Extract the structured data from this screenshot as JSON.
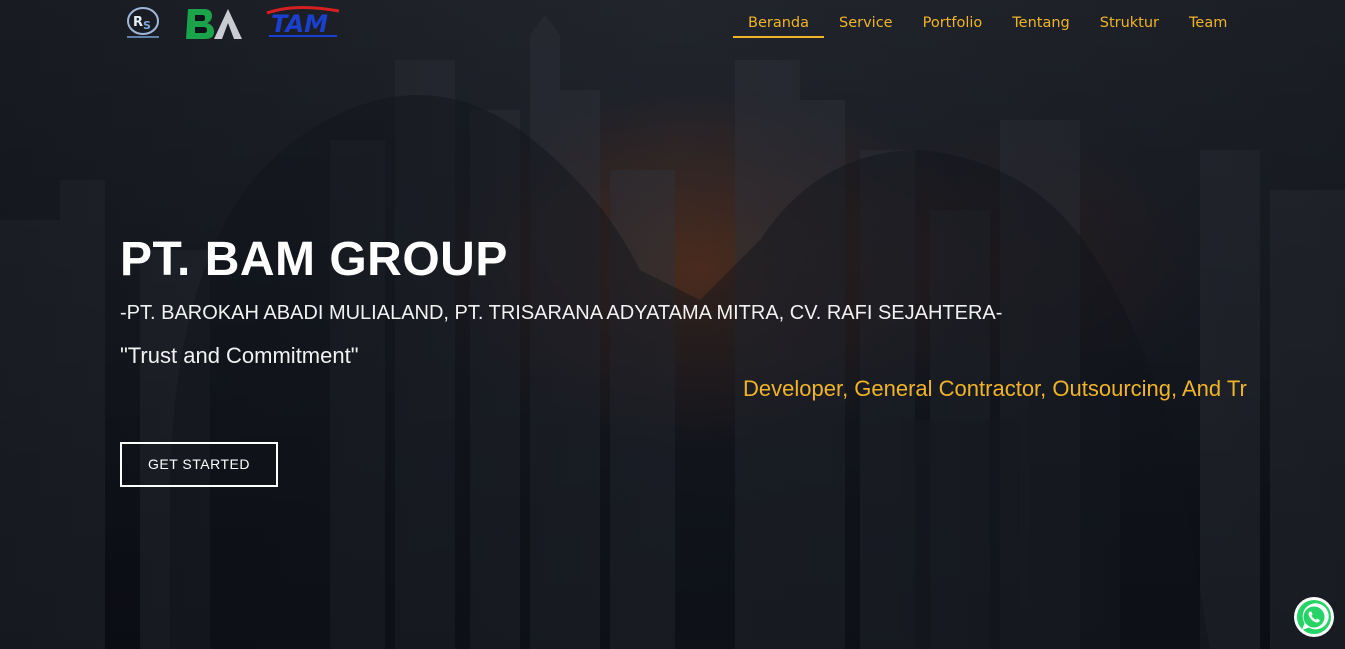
{
  "header": {
    "logos": [
      {
        "name": "rs-logo",
        "text": "RS"
      },
      {
        "name": "ba-logo",
        "text": "BA"
      },
      {
        "name": "tam-logo",
        "text": "TAM"
      }
    ],
    "nav": [
      {
        "label": "Beranda",
        "active": true
      },
      {
        "label": "Service",
        "active": false
      },
      {
        "label": "Portfolio",
        "active": false
      },
      {
        "label": "Tentang",
        "active": false
      },
      {
        "label": "Struktur",
        "active": false
      },
      {
        "label": "Team",
        "active": false
      }
    ]
  },
  "hero": {
    "title": "PT. BAM GROUP",
    "subtitle": "-PT. BAROKAH ABADI MULIALAND, PT. TRISARANA ADYATAMA MITRA, CV. RAFI SEJAHTERA-",
    "tagline": "\"Trust and Commitment\"",
    "marquee": "Developer, General Contractor, Outsourcing, And Tr",
    "cta_label": "GET STARTED"
  },
  "floating": {
    "icon": "whatsapp-icon"
  },
  "colors": {
    "accent": "#f0b428",
    "text": "#ffffff",
    "background": "#1b1e27"
  }
}
